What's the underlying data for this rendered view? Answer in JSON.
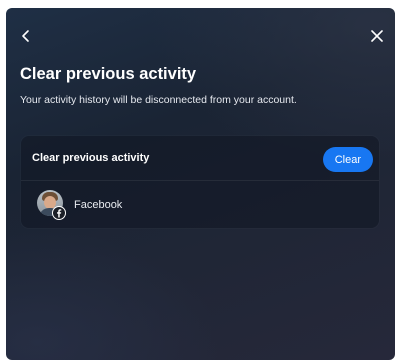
{
  "dialog": {
    "back_icon": "chevron-left-icon",
    "close_icon": "close-icon",
    "title": "Clear previous activity",
    "subtitle": "Your activity history will be disconnected from your account."
  },
  "card": {
    "title": "Clear previous activity",
    "clear_label": "Clear",
    "clear_color": "#1877f2",
    "accounts": [
      {
        "name": "Facebook",
        "avatar_icon": "profile-photo",
        "badge_icon": "facebook-icon"
      }
    ]
  }
}
